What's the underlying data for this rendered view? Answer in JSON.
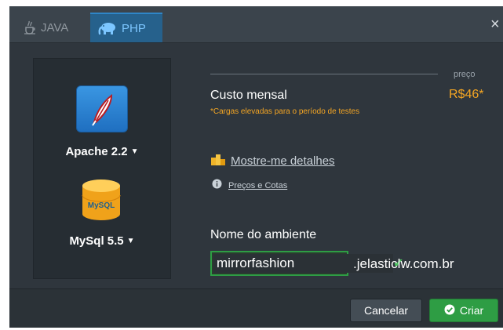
{
  "tabs": [
    {
      "label": "JAVA",
      "icon": "java-cup-icon"
    },
    {
      "label": "PHP",
      "icon": "php-elephant-icon"
    }
  ],
  "close_label": "×",
  "stack": {
    "apache": {
      "label": "Apache 2.2",
      "icon": "apache-feather-icon"
    },
    "mysql": {
      "label": "MySql 5.5",
      "icon": "mysql-database-icon",
      "badge": "MySQL"
    }
  },
  "pricing": {
    "preco_label": "preço",
    "custo_label": "Custo mensal",
    "value": "R$46*",
    "note": "*Cargas elevadas para o período de testes",
    "details_link": "Mostre-me detalhes",
    "precos_link": "Preços e Cotas"
  },
  "environment": {
    "label": "Nome do ambiente",
    "value": "mirrorfashion",
    "suffix": ".jelasticlw.com.br"
  },
  "buttons": {
    "cancel": "Cancelar",
    "create": "Criar"
  },
  "colors": {
    "accent_blue": "#26618c",
    "price_orange": "#f5a623",
    "success_green": "#2e9d44"
  }
}
